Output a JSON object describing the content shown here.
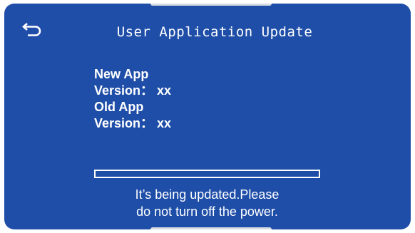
{
  "header": {
    "title": "User Application Update",
    "back_icon": "back-arrow-icon"
  },
  "info": {
    "new_app_label": "New App",
    "new_app_version": "Version： xx",
    "old_app_label": "Old App",
    "old_app_version": "Version： xx"
  },
  "progress": {
    "fraction": 0
  },
  "status": {
    "line1": "It’s being updated.Please",
    "line2": "do not turn off the power."
  },
  "colors": {
    "background": "#1f4ea8",
    "foreground": "#ffffff"
  }
}
